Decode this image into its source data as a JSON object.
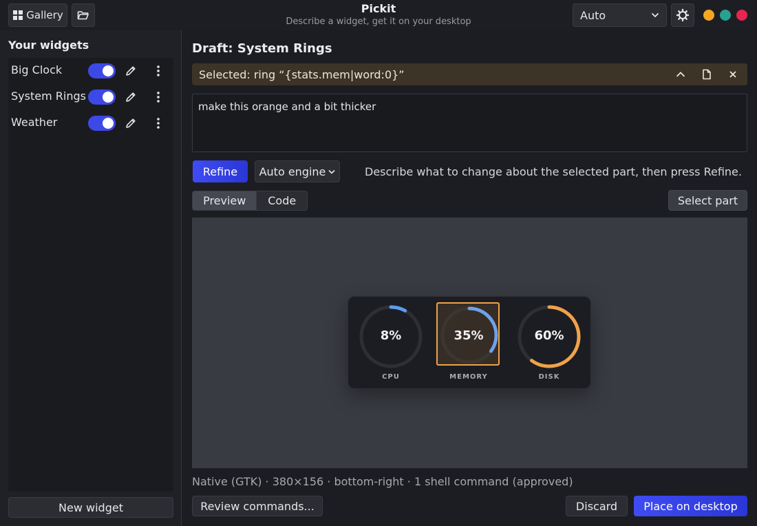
{
  "header": {
    "gallery_label": "Gallery",
    "title": "Pickit",
    "subtitle": "Describe a widget, get it on your desktop",
    "mode_value": "Auto",
    "window_dots": [
      "#f5a623",
      "#26a28f",
      "#e8254f"
    ]
  },
  "sidebar": {
    "heading": "Your widgets",
    "items": [
      {
        "label": "Big Clock",
        "enabled": true
      },
      {
        "label": "System Rings",
        "enabled": true
      },
      {
        "label": "Weather",
        "enabled": true
      }
    ],
    "new_widget_label": "New widget"
  },
  "main": {
    "draft_title": "Draft: System Rings",
    "selection": {
      "text": "Selected: ring “{stats.mem|word:0}”"
    },
    "prompt_value": "make this orange and a bit thicker",
    "refine_label": "Refine",
    "engine_label": "Auto engine",
    "hint": "Describe what to change about the selected part, then press Refine.",
    "tabs": [
      {
        "label": "Preview",
        "active": true
      },
      {
        "label": "Code",
        "active": false
      }
    ],
    "select_part_label": "Select part",
    "preview": {
      "rings": [
        {
          "label": "CPU",
          "value_text": "8%",
          "value": 8,
          "color": "#5b9cf0",
          "selected": false
        },
        {
          "label": "MEMORY",
          "value_text": "35%",
          "value": 35,
          "color": "#6fa2e8",
          "selected": true
        },
        {
          "label": "DISK",
          "value_text": "60%",
          "value": 60,
          "color": "#f0a24a",
          "selected": false
        }
      ]
    },
    "status_line": "Native (GTK) · 380×156 · bottom-right · 1 shell command (approved)",
    "review_label": "Review commands...",
    "discard_label": "Discard",
    "place_label": "Place on desktop"
  },
  "colors": {
    "accent": "#3d49e6",
    "selection": "#f0a24a"
  }
}
